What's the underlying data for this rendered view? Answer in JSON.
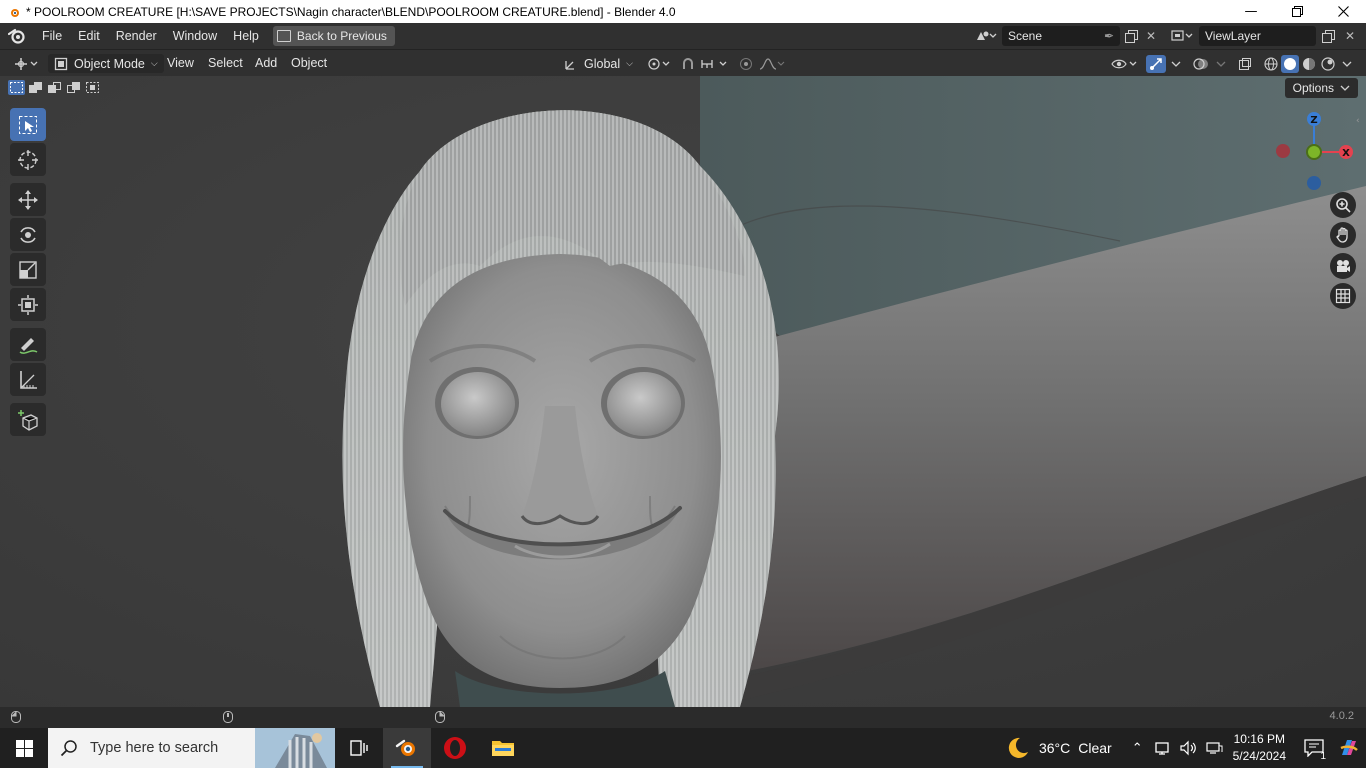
{
  "window": {
    "title": "* POOLROOM CREATURE [H:\\SAVE PROJECTS\\Nagin character\\BLEND\\POOLROOM CREATURE.blend] - Blender 4.0",
    "controls": [
      "minimize-icon",
      "restore-icon",
      "close-icon"
    ]
  },
  "topbar": {
    "menus": [
      "File",
      "Edit",
      "Render",
      "Window",
      "Help"
    ],
    "back_label": "Back to Previous",
    "scene": "Scene",
    "view_layer": "ViewLayer"
  },
  "viewport_header": {
    "mode": "Object Mode",
    "menus": [
      "View",
      "Select",
      "Add",
      "Object"
    ],
    "transform_orientation": "Global"
  },
  "viewport": {
    "options_label": "Options",
    "gizmo": {
      "z": "Z",
      "x": "X"
    },
    "colors": {
      "x_axis": "#e4424f",
      "y_axis": "#7db528",
      "z_axis": "#3a7ed6",
      "active_tool": "#4772b3"
    }
  },
  "statusbar": {
    "version": "4.0.2"
  },
  "taskbar": {
    "search_placeholder": "Type here to search",
    "weather_temp": "36°C",
    "weather_cond": "Clear",
    "time": "10:16 PM",
    "date": "5/24/2024",
    "notification_count": "1"
  }
}
